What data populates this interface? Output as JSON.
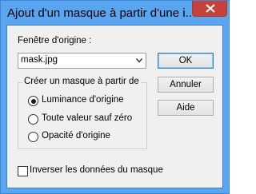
{
  "window": {
    "title": "Ajout d'un masque à partir d'une i...",
    "accent_color": "#5aa5f0",
    "close_color": "#c7413b"
  },
  "source": {
    "label": "Fenêtre d'origine :",
    "selected": "mask.jpg"
  },
  "buttons": {
    "ok": "OK",
    "cancel": "Annuler",
    "help": "Aide"
  },
  "group": {
    "legend": "Créer un masque à partir de",
    "options": [
      {
        "label": "Luminance d'origine",
        "selected": true
      },
      {
        "label": "Toute valeur sauf zéro",
        "selected": false
      },
      {
        "label": "Opacité d'origine",
        "selected": false
      }
    ]
  },
  "invert": {
    "label": "Inverser les données du masque",
    "checked": false
  },
  "icons": {
    "close": "close-icon",
    "dropdown": "chevron-down-icon"
  }
}
